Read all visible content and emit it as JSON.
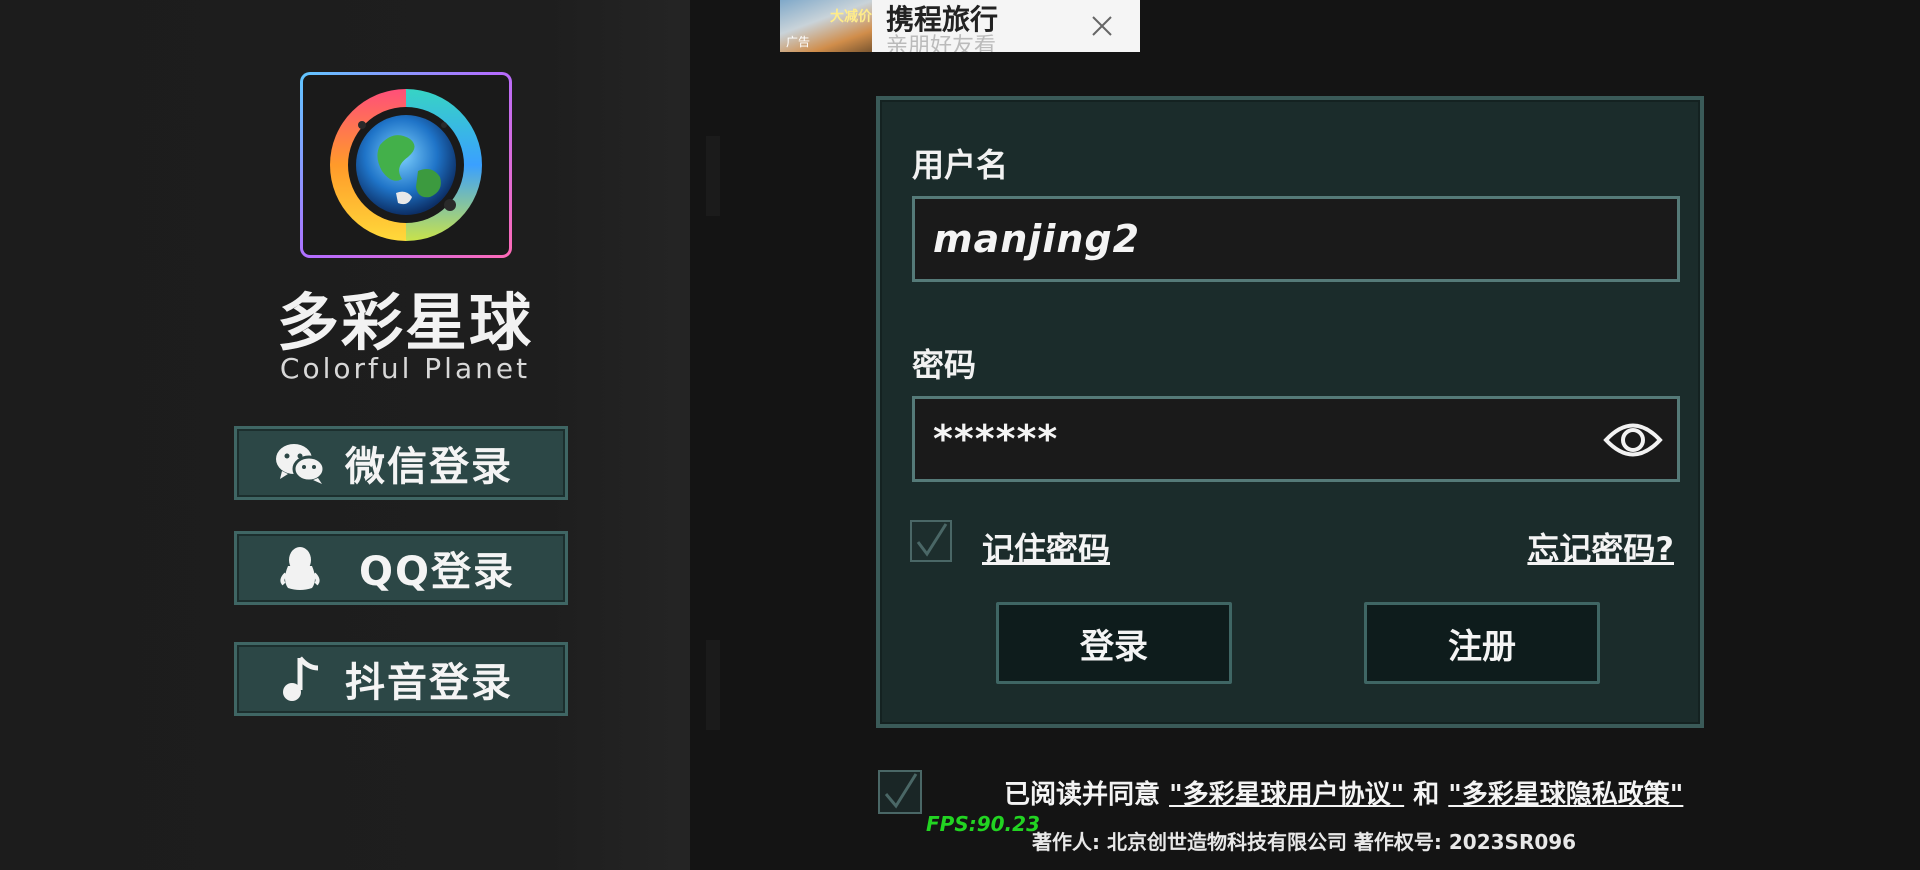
{
  "app": {
    "title": "多彩星球",
    "subtitle": "Colorful Planet"
  },
  "social_login": [
    {
      "label": "微信登录",
      "icon": "wechat-icon"
    },
    {
      "label": "QQ登录",
      "icon": "qq-penguin-icon"
    },
    {
      "label": "抖音登录",
      "icon": "music-note-icon"
    }
  ],
  "ad": {
    "title": "携程旅行",
    "subtitle": "亲朋好友看",
    "thumb_tag": "广告",
    "thumb_mark": "大减价"
  },
  "form": {
    "username_label": "用户名",
    "username_value": "manjing2",
    "password_label": "密码",
    "password_value": "******",
    "remember_label": "记住密码",
    "remember_checked": true,
    "forgot_label": "忘记密码?",
    "login_label": "登录",
    "register_label": "注册"
  },
  "agreement": {
    "checked": true,
    "prefix": "已阅读并同意 ",
    "user_agreement": "\"多彩星球用户协议\"",
    "and": " 和 ",
    "privacy_policy": "\"多彩星球隐私政策\""
  },
  "footer": {
    "fps": "FPS:90.23",
    "copyright": "著作人: 北京创世造物科技有限公司     著作权号: 2023SR096"
  },
  "colors": {
    "panel_bg": "#1b2c2b",
    "panel_border": "#3a5a58",
    "button_bg": "#2c4746",
    "fps_green": "#22d422"
  }
}
